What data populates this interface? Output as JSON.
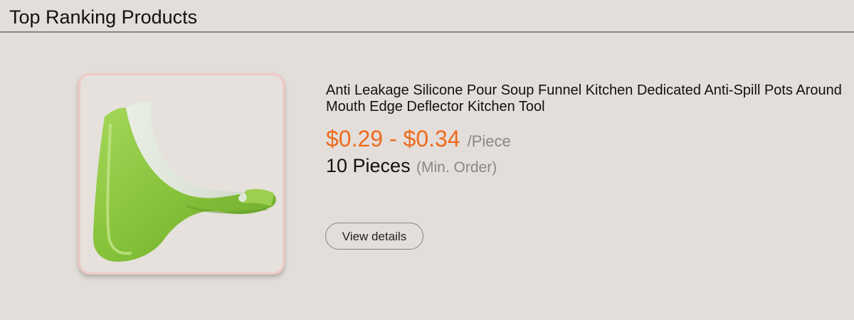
{
  "section": {
    "title": "Top Ranking Products"
  },
  "product": {
    "title": "Anti Leakage Silicone Pour Soup Funnel Kitchen Dedicated Anti-Spill Pots Around Mouth Edge Deflector Kitchen Tool",
    "price": "$0.29 - $0.34",
    "unit": "/Piece",
    "moq_quantity": "10 Pieces",
    "moq_note": "(Min. Order)",
    "view_details_label": "View details",
    "image_icon": "green-silicone-funnel-image",
    "colors": {
      "price": "#ee6a1c",
      "product_green": "#8cc63f",
      "frame_border": "#f0c9c3"
    }
  }
}
